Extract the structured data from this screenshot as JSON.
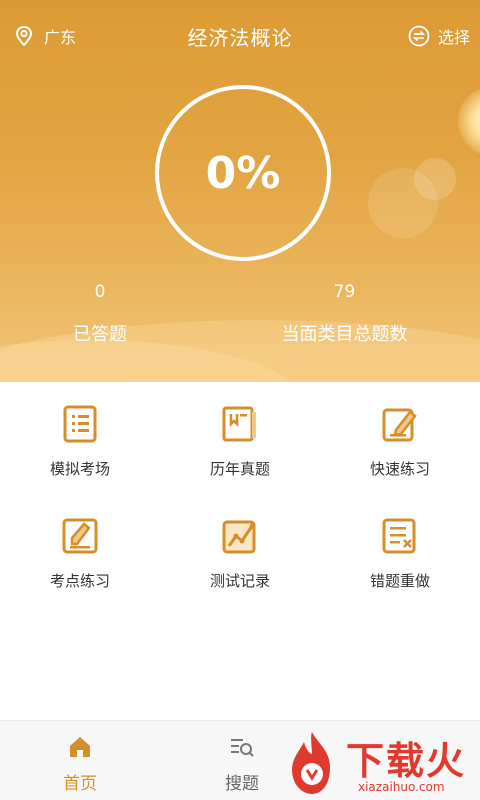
{
  "header": {
    "location": "广东",
    "title": "经济法概论",
    "select_label": "选择"
  },
  "progress": {
    "percent_text": "0%",
    "value": 0
  },
  "stats": {
    "answered_count": "0",
    "answered_label": "已答题",
    "total_count": "79",
    "total_label": "当面类目总题数"
  },
  "menu": {
    "items": [
      {
        "label": "模拟考场",
        "icon": "list-doc-icon"
      },
      {
        "label": "历年真题",
        "icon": "book-icon"
      },
      {
        "label": "快速练习",
        "icon": "edit-icon"
      },
      {
        "label": "考点练习",
        "icon": "pencil-doc-icon"
      },
      {
        "label": "测试记录",
        "icon": "chart-icon"
      },
      {
        "label": "错题重做",
        "icon": "wrong-doc-icon"
      }
    ]
  },
  "tabs": {
    "home": "首页",
    "search": "搜题"
  },
  "watermark": {
    "brand": "下载火",
    "domain": "xiazaihuo.com"
  },
  "colors": {
    "accent": "#d48e2a",
    "hero_top": "#dc9a34",
    "hero_bottom": "#f2c47a",
    "watermark": "#e0392d"
  }
}
